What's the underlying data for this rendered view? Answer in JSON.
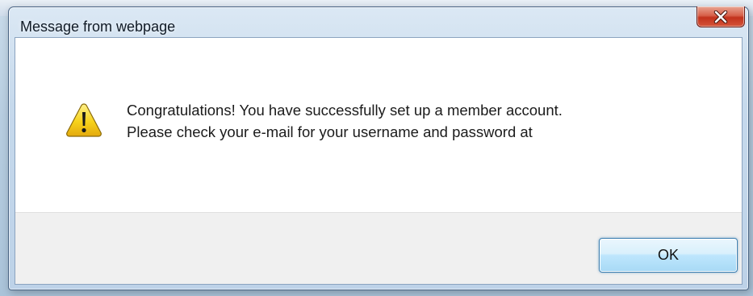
{
  "dialog": {
    "title": "Message from webpage",
    "icon": "warning-icon",
    "message_lines": [
      "Congratulations! You have successfully set up a member account.",
      "Please check your e-mail for your username and password at"
    ],
    "ok_label": "OK",
    "close_icon": "close-icon"
  },
  "colors": {
    "close_button": "#c2321c",
    "ok_button_border": "#3c7fb1",
    "footer_bg": "#f0f0f0",
    "warning_yellow": "#f7d21a"
  }
}
